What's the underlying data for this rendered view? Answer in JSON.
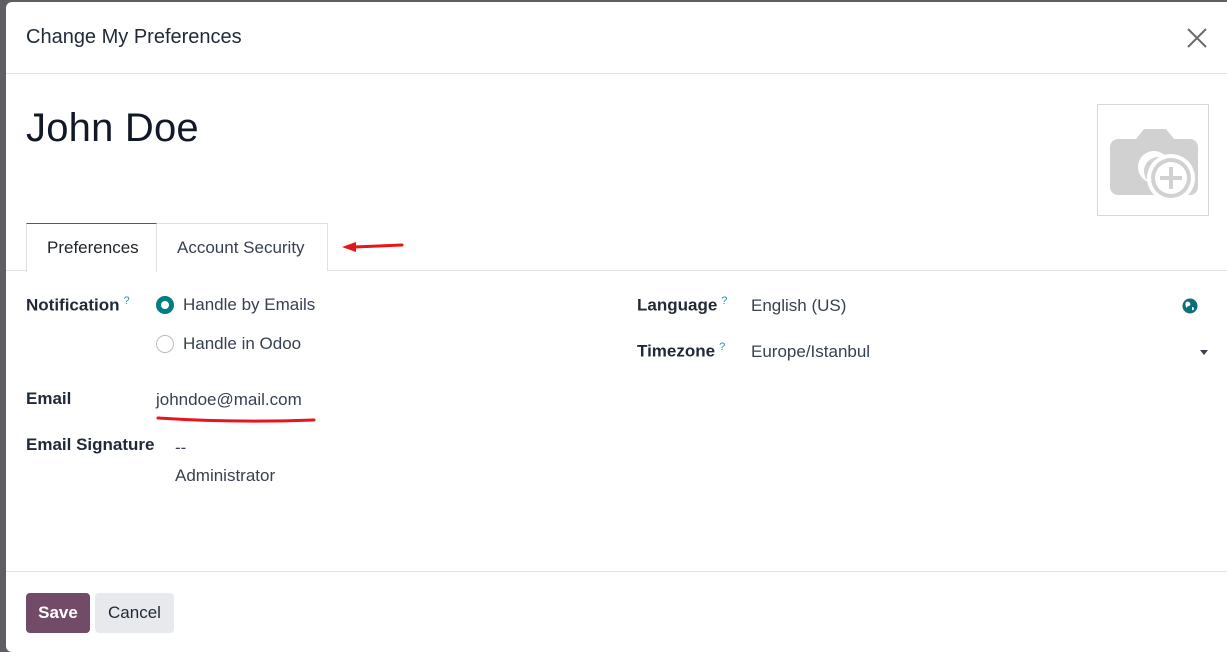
{
  "dialog": {
    "title": "Change My Preferences",
    "close_icon": "close-icon"
  },
  "record": {
    "name": "John Doe",
    "avatar_icon": "camera-plus-icon"
  },
  "tabs": [
    {
      "label": "Preferences",
      "active": true
    },
    {
      "label": "Account Security",
      "active": false
    }
  ],
  "fields": {
    "notification": {
      "label": "Notification",
      "help": "?",
      "options": [
        {
          "label": "Handle by Emails",
          "checked": true
        },
        {
          "label": "Handle in Odoo",
          "checked": false
        }
      ]
    },
    "email": {
      "label": "Email",
      "value": "johndoe@mail.com"
    },
    "signature": {
      "label": "Email Signature",
      "lines": [
        "--",
        "Administrator"
      ]
    },
    "language": {
      "label": "Language",
      "help": "?",
      "value": "English (US)",
      "icon": "globe-icon"
    },
    "timezone": {
      "label": "Timezone",
      "help": "?",
      "value": "Europe/Istanbul",
      "icon": "caret-down-icon"
    }
  },
  "footer": {
    "save_label": "Save",
    "cancel_label": "Cancel"
  },
  "colors": {
    "primary": "#714b67",
    "radio_accent": "#017e84",
    "help": "#2b8fb0",
    "annotation": "#e8141c"
  }
}
